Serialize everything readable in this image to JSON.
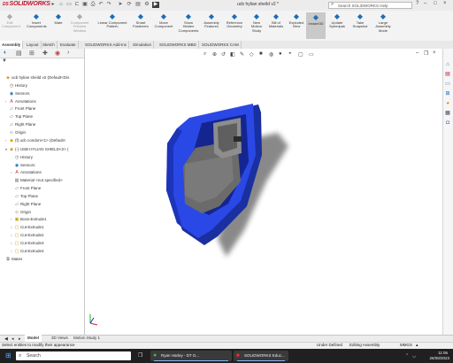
{
  "app": {
    "name": "SOLIDWORKS",
    "brand": "DS",
    "document_title": "ucb hylian sheild v2 *",
    "brand_color": "#c8102e",
    "accent_color": "#1f6db5"
  },
  "search": {
    "placeholder": "Search SOLIDWORKS Help"
  },
  "ribbon": {
    "buttons": [
      {
        "id": "edit-component",
        "label": "Edit\nComponent",
        "icon": "edit-component-icon",
        "disabled": true
      },
      {
        "id": "insert-components",
        "label": "Insert\nComponents",
        "icon": "insert-components-icon"
      },
      {
        "id": "mate",
        "label": "Mate",
        "icon": "mate-icon"
      },
      {
        "id": "component-preview",
        "label": "Component\nPreview\nWindow",
        "icon": "preview-icon",
        "disabled": true
      },
      {
        "id": "linear-pattern",
        "label": "Linear Component\nPattern",
        "icon": "linear-pattern-icon"
      },
      {
        "id": "smart-fasteners",
        "label": "Smart\nFasteners",
        "icon": "smart-fasteners-icon"
      },
      {
        "id": "move-component",
        "label": "Move\nComponent",
        "icon": "move-component-icon"
      },
      {
        "id": "show-hidden",
        "label": "Show\nHidden\nComponents",
        "icon": "show-hidden-icon"
      },
      {
        "id": "assembly-features",
        "label": "Assembly\nFeatures",
        "icon": "assembly-features-icon"
      },
      {
        "id": "reference-geometry",
        "label": "Reference\nGeometry",
        "icon": "reference-geometry-icon"
      },
      {
        "id": "new-motion-study",
        "label": "New\nMotion\nStudy",
        "icon": "motion-study-icon"
      },
      {
        "id": "bill-of-materials",
        "label": "Bill of\nMaterials",
        "icon": "bom-icon"
      },
      {
        "id": "exploded-view",
        "label": "Exploded\nView",
        "icon": "exploded-view-icon"
      },
      {
        "id": "instant3d",
        "label": "Instant3D",
        "icon": "instant3d-icon",
        "active": true
      },
      {
        "id": "update-speedpak",
        "label": "Update\nSpeedpak",
        "icon": "speedpak-icon"
      },
      {
        "id": "take-snapshot",
        "label": "Take\nSnapshot",
        "icon": "snapshot-icon"
      },
      {
        "id": "large-assembly",
        "label": "Large\nAssembly\nMode",
        "icon": "large-assembly-icon"
      }
    ]
  },
  "tabs": [
    "Assembly",
    "Layout",
    "Sketch",
    "Evaluate",
    "SOLIDWORKS Add-Ins",
    "Simulation",
    "SOLIDWORKS MBD",
    "SOLIDWORKS CAM"
  ],
  "tree": {
    "items": [
      {
        "label": "ucb hylian sheild v2  (Default<Dis",
        "icon": "assembly-icon",
        "level": 0
      },
      {
        "label": "History",
        "icon": "history-icon",
        "level": 1
      },
      {
        "label": "Sensors",
        "icon": "sensors-icon",
        "level": 1
      },
      {
        "label": "Annotations",
        "icon": "annotations-icon",
        "level": 1,
        "arrow": true
      },
      {
        "label": "Front Plane",
        "icon": "plane-icon",
        "level": 1
      },
      {
        "label": "Top Plane",
        "icon": "plane-icon",
        "level": 1
      },
      {
        "label": "Right Plane",
        "icon": "plane-icon",
        "level": 1
      },
      {
        "label": "Origin",
        "icon": "origin-icon",
        "level": 1
      },
      {
        "label": "(f) ucb condom<1> (Default<",
        "icon": "part-icon",
        "level": 1,
        "arrow": true
      },
      {
        "label": "(-) USB HYLIAN SHIELD<2> (",
        "icon": "part-icon",
        "level": 1,
        "arrow": true,
        "open": true
      },
      {
        "label": "History",
        "icon": "history-icon",
        "level": 2
      },
      {
        "label": "Sensors",
        "icon": "sensors-icon",
        "level": 2
      },
      {
        "label": "Annotations",
        "icon": "annotations-icon",
        "level": 2,
        "arrow": true
      },
      {
        "label": "Material <not specified>",
        "icon": "material-icon",
        "level": 2
      },
      {
        "label": "Front Plane",
        "icon": "plane-icon",
        "level": 2
      },
      {
        "label": "Top Plane",
        "icon": "plane-icon",
        "level": 2
      },
      {
        "label": "Right Plane",
        "icon": "plane-icon",
        "level": 2
      },
      {
        "label": "Origin",
        "icon": "origin-icon",
        "level": 2
      },
      {
        "label": "Boss-Extrude1",
        "icon": "extrude-icon",
        "level": 2,
        "arrow": true
      },
      {
        "label": "Cut-Extrude1",
        "icon": "cut-icon",
        "level": 2,
        "arrow": true
      },
      {
        "label": "Cut-Extrude2",
        "icon": "cut-icon",
        "level": 2,
        "arrow": true
      },
      {
        "label": "Cut-Extrude3",
        "icon": "cut-icon",
        "level": 2,
        "arrow": true
      },
      {
        "label": "Cut-Extrude4",
        "icon": "cut-icon",
        "level": 2,
        "arrow": true
      },
      {
        "label": "Mates",
        "icon": "mates-icon",
        "level": 0
      }
    ]
  },
  "bottom_tabs": [
    "Model",
    "3D Views",
    "Motion Study 1"
  ],
  "status": {
    "hint": "Select entities to modify their appearance",
    "state": "Under Defined",
    "mode": "Editing Assembly",
    "units": "MMGS"
  },
  "taskbar": {
    "search_placeholder": "Search",
    "apps": [
      {
        "label": "Ryan Harley - DT G...",
        "icon": "chrome-icon"
      },
      {
        "label": "SOLIDWORKS Educ...",
        "icon": "solidworks-icon"
      }
    ],
    "time": "11:06",
    "date": "26/08/2023"
  }
}
